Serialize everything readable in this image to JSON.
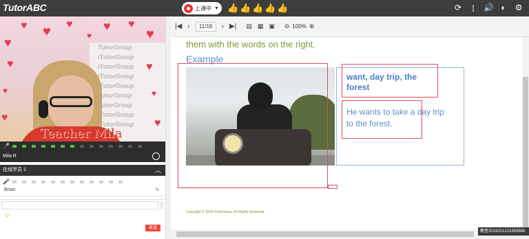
{
  "app": {
    "logo": "TutorABC"
  },
  "status": {
    "label": "上课中",
    "color": "#e8352b"
  },
  "thumbs": [
    "👍",
    "👍",
    "👍",
    "👍",
    "👍"
  ],
  "top_icons": [
    "refresh-icon",
    "info-icon",
    "speaker-icon",
    "headset-icon",
    "gear-icon"
  ],
  "teacher": {
    "overlay_name": "Teacher Mila",
    "short_name": "Mila R",
    "audio_levels_on": 7,
    "audio_levels_total": 14
  },
  "poster_lines": [
    "TutorGroup",
    "iTutorGroup",
    "iTutorGroup",
    "iTutorGroup",
    "iTutorGroup",
    "TutorGroup",
    "TutorGroup",
    "iTutorGroup",
    "iTutorGroup"
  ],
  "students": {
    "header": "在线学员 1",
    "items": [
      {
        "name": "Brian"
      }
    ]
  },
  "chat": {
    "send_label": "发送"
  },
  "toolbar": {
    "page_indicator": "11/16",
    "zoom": "100%"
  },
  "slide": {
    "instruction_fragment": "them with the words on the right.",
    "example_label": "Example",
    "answer_title": "want, day trip, the forest",
    "answer_sentence": "He wants to take a day trip to the forest.",
    "copyright": "Copyright © 2018 iTutorGroup. All Rights Reserved."
  },
  "watermark": "教室20190212216598​86"
}
